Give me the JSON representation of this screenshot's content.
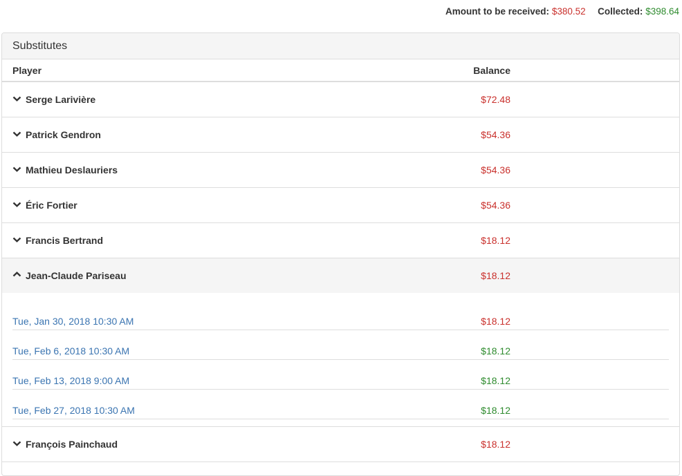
{
  "summary": {
    "received_label": "Amount to be received:",
    "received_value": "$380.52",
    "collected_label": "Collected:",
    "collected_value": "$398.64"
  },
  "panel": {
    "title": "Substitutes",
    "columns": {
      "player": "Player",
      "balance": "Balance"
    }
  },
  "players": [
    {
      "name": "Serge Larivière",
      "balance": "$72.48"
    },
    {
      "name": "Patrick Gendron",
      "balance": "$54.36"
    },
    {
      "name": "Mathieu Deslauriers",
      "balance": "$54.36"
    },
    {
      "name": "Éric Fortier",
      "balance": "$54.36"
    },
    {
      "name": "Francis Bertrand",
      "balance": "$18.12"
    },
    {
      "name": "Jean-Claude Pariseau",
      "balance": "$18.12"
    },
    {
      "name": "François Painchaud",
      "balance": "$18.12"
    }
  ],
  "details": [
    {
      "date": "Tue, Jan 30, 2018 10:30 AM",
      "balance": "$18.12",
      "status": "due"
    },
    {
      "date": "Tue, Feb 6, 2018 10:30 AM",
      "balance": "$18.12",
      "status": "paid"
    },
    {
      "date": "Tue, Feb 13, 2018 9:00 AM",
      "balance": "$18.12",
      "status": "paid"
    },
    {
      "date": "Tue, Feb 27, 2018 10:30 AM",
      "balance": "$18.12",
      "status": "paid"
    }
  ],
  "colors": {
    "due": "#c9302c",
    "paid": "#2e8b2e",
    "link": "#3a74b1"
  },
  "icons": {
    "collapsed": "chevron-down-icon",
    "expanded": "chevron-up-icon"
  }
}
